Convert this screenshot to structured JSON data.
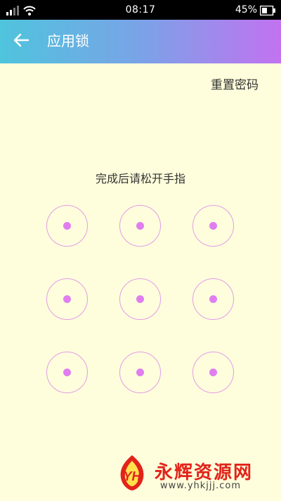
{
  "status_bar": {
    "time": "08:17",
    "battery_percent": "45%",
    "icons": [
      "signal-icon",
      "wifi-icon",
      "battery-icon"
    ]
  },
  "header": {
    "title": "应用锁",
    "back_icon": "arrow-left-icon",
    "gradient": [
      "#4fc4dd",
      "#c272f0"
    ]
  },
  "reset": {
    "label": "重置密码"
  },
  "instruction": {
    "text": "完成后请松开手指"
  },
  "pattern": {
    "nodes": [
      1,
      2,
      3,
      4,
      5,
      6,
      7,
      8,
      9
    ],
    "ring_color": "#e39ce8",
    "dot_color": "#e07ef0"
  },
  "watermark": {
    "logo_text": "YH",
    "text": "永辉资源网",
    "url": "www.yhkjjj.com"
  },
  "colors": {
    "background": "#fefedc"
  }
}
